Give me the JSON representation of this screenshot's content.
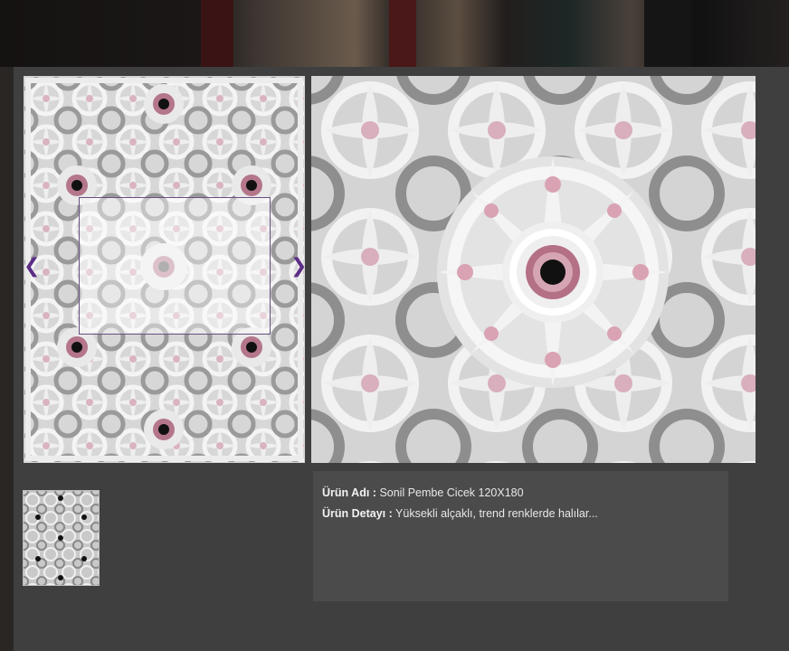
{
  "gallery": {
    "prev_arrow": "❮",
    "next_arrow": "❯"
  },
  "product": {
    "name_label": "Ürün Adı :",
    "name_value": "Sonil Pembe Cicek 120X180",
    "detail_label": "Ürün Detayı :",
    "detail_value": "Yüksekli alçaklı, trend renklerde halılar..."
  },
  "colors": {
    "accent": "#5c2d86",
    "modal_bg": "#3f3f3f",
    "info_bg": "#4b4b4b",
    "rug_pink": "#c98a9c",
    "rug_grey": "#8a8a8a"
  },
  "icons": {
    "prev": "chevron-left-icon",
    "next": "chevron-right-icon"
  }
}
